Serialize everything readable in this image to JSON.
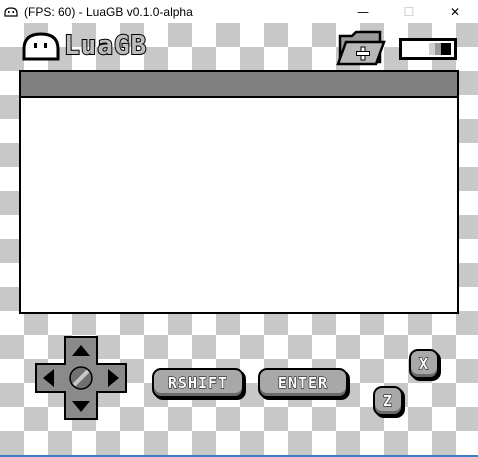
{
  "window": {
    "title": "(FPS: 60) - LuaGB v0.1.0-alpha",
    "controls": {
      "minimize": "—",
      "maximize": "☐",
      "close": "✕"
    }
  },
  "header": {
    "logo_text": "LuaGB",
    "folder_icon": "folder-plus-icon",
    "battery_icon": "battery-icon"
  },
  "screen": {},
  "controls": {
    "rshift_label": "RSHIFT",
    "enter_label": "ENTER",
    "z_label": "Z",
    "x_label": "X"
  },
  "colors": {
    "checker_dark": "#c8c8c8",
    "screen_bar": "#808080",
    "button_fill": "#a8a8a8",
    "taskbar_accent": "#3c7fc6"
  }
}
